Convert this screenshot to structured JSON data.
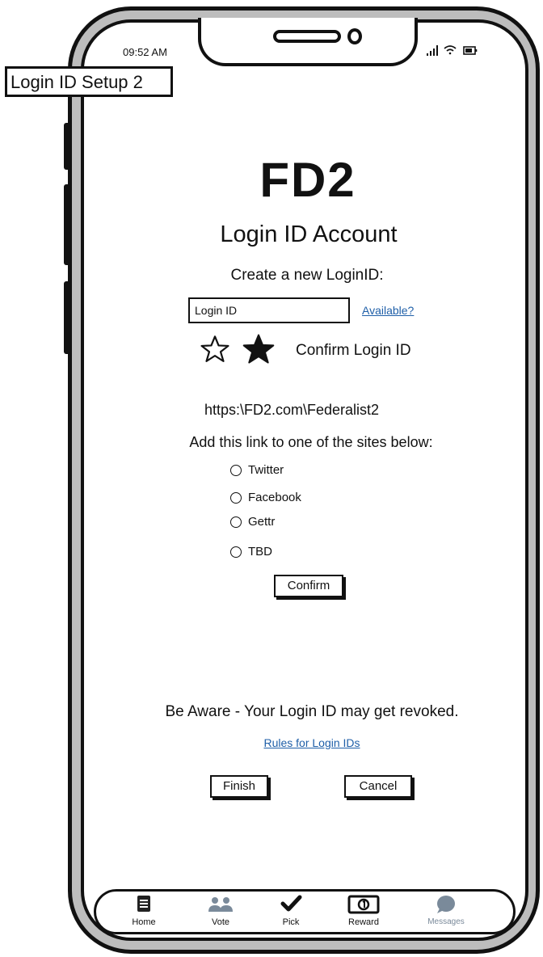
{
  "status_bar": {
    "time": "09:52 AM"
  },
  "screen_label": "Login ID Setup 2",
  "brand": "FD2",
  "heading": "Login ID Account",
  "create_prompt": "Create a new LoginID:",
  "login_input": {
    "value": "Login ID",
    "placeholder": ""
  },
  "available_link": "Available?",
  "confirm_login_id_label": "Confirm Login ID",
  "profile_url": "https:\\FD2.com\\Federalist2",
  "instruction": "Add this link to one of the sites below:",
  "sites": [
    {
      "label": "Twitter"
    },
    {
      "label": "Facebook"
    },
    {
      "label": "Gettr"
    },
    {
      "label": "TBD"
    }
  ],
  "confirm_button": "Confirm",
  "warning": "Be Aware - Your Login ID may get revoked.",
  "rules_link": "Rules for Login IDs",
  "finish_button": "Finish",
  "cancel_button": "Cancel",
  "tabs": [
    {
      "label": "Home",
      "icon": "document-icon"
    },
    {
      "label": "Vote",
      "icon": "people-icon"
    },
    {
      "label": "Pick",
      "icon": "checkmark-icon"
    },
    {
      "label": "Reward",
      "icon": "banknote-icon"
    },
    {
      "label": "Messages",
      "icon": "chat-bubble-icon"
    }
  ],
  "colors": {
    "link": "#1f5fa8",
    "phone_frame": "#bdbdbd",
    "inactive_tab": "#7a8a9a"
  }
}
